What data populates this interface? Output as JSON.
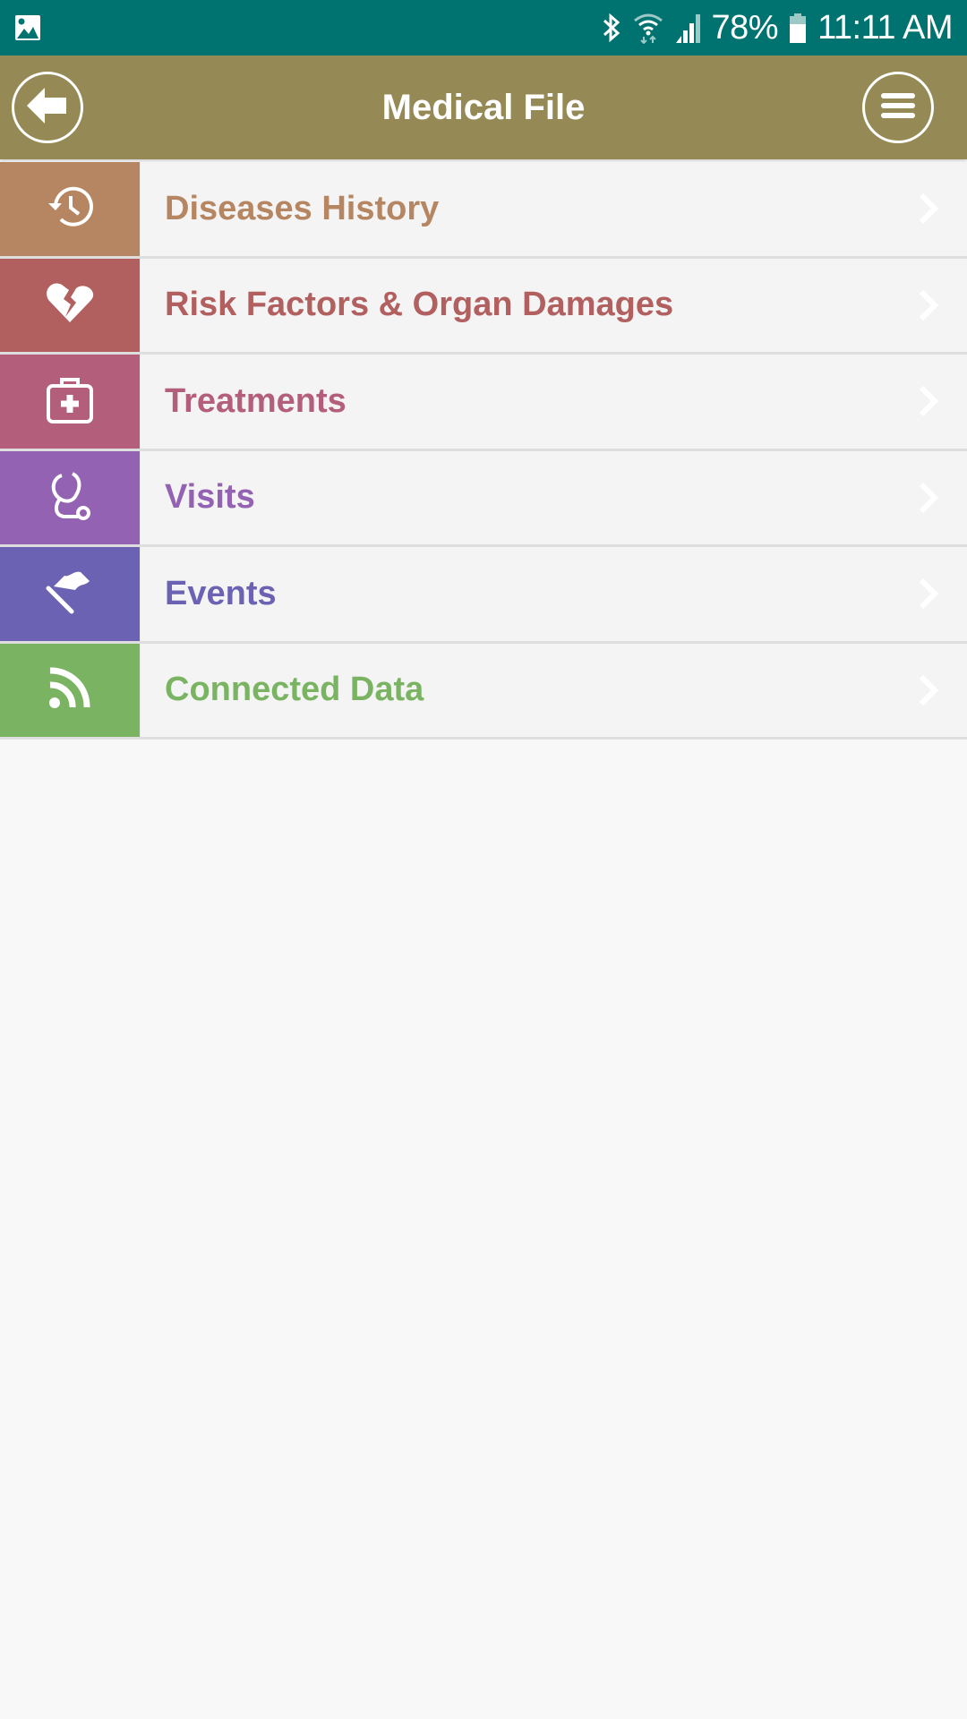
{
  "status_bar": {
    "left_icon": "gallery-notification-icon",
    "icons": [
      "bluetooth-icon",
      "wifi-icon",
      "signal-icon",
      "battery-icon"
    ],
    "battery_percent": "78%",
    "time": "11:11 AM",
    "background": "#007370"
  },
  "header": {
    "title": "Medical File",
    "back_icon": "arrow-left-icon",
    "menu_icon": "hamburger-menu-icon",
    "background": "#958A55"
  },
  "menu": {
    "items": [
      {
        "label": "Diseases History",
        "icon": "history-clock-icon",
        "color": "#B58661"
      },
      {
        "label": "Risk Factors & Organ Damages",
        "icon": "broken-heart-icon",
        "color": "#B25F5F"
      },
      {
        "label": "Treatments",
        "icon": "first-aid-kit-icon",
        "color": "#B35E7A"
      },
      {
        "label": "Visits",
        "icon": "stethoscope-icon",
        "color": "#9462B2"
      },
      {
        "label": "Events",
        "icon": "flag-icon",
        "color": "#6B62B3"
      },
      {
        "label": "Connected Data",
        "icon": "rss-feed-icon",
        "color": "#7AB462"
      }
    ]
  }
}
